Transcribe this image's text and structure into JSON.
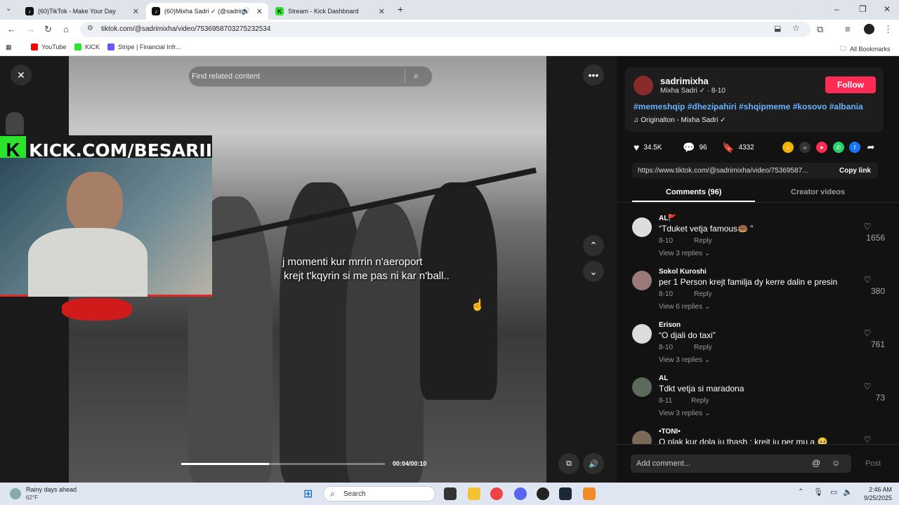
{
  "browser": {
    "tabs": [
      {
        "title": "(60)TikTok - Make Your Day",
        "active": false
      },
      {
        "title": "(60)Mixha Sadri ✓ (@sadrim",
        "active": true
      },
      {
        "title": "Stream - Kick Dashboard",
        "active": false
      }
    ],
    "url": "tiktok.com/@sadrimixha/video/7536958703275232534",
    "bookmarks": [
      {
        "label": "YouTube",
        "color": "#ff0000"
      },
      {
        "label": "KICK",
        "color": "#2ae32a"
      },
      {
        "label": "Stripe | Financial Infr...",
        "color": "#635bff"
      }
    ],
    "all_bookmarks": "All Bookmarks"
  },
  "video": {
    "search_placeholder": "Find related content",
    "caption_line1": "j momenti kur mrrin n'aeroport",
    "caption_line2": "krejt t'kqyrin si me pas ni kar n'ball..",
    "time": "00:04/00:10",
    "progress": 0.43
  },
  "overlay": {
    "kick_k": "K",
    "kick_text": "KICK.COM/BESARII"
  },
  "post": {
    "username": "sadrimixha",
    "subline": "Mixha Sadri ✓ · 8-10",
    "follow": "Follow",
    "hashtags": "#memeshqip #dhezipahiri #shqipmeme #kosovo #albania",
    "sound": "♫  Originalton - Mixha Sadri ✓",
    "likes": "34.5K",
    "comments_count": "96",
    "saves": "4332",
    "link": "https://www.tiktok.com/@sadrimixha/video/75369587...",
    "copy_link": "Copy link",
    "tab_comments": "Comments (96)",
    "tab_creator": "Creator videos",
    "add_comment": "Add comment...",
    "post_button": "Post"
  },
  "comments": [
    {
      "name": "AL🚩",
      "text": "“Tduket vetja famous🍩 ”",
      "date": "8-10",
      "reply": "Reply",
      "view": "View 3 replies ⌄",
      "likes": "1656"
    },
    {
      "name": "Sokol Kuroshi",
      "text": "per 1 Person krejt familja dy kerre dalin e presin",
      "date": "8-10",
      "reply": "Reply",
      "view": "View 6 replies ⌄",
      "likes": "380"
    },
    {
      "name": "Erison",
      "text": "“O djali do taxi”",
      "date": "8-10",
      "reply": "Reply",
      "view": "View 3 replies ⌄",
      "likes": "761"
    },
    {
      "name": "AL",
      "text": "Tdkt vetja si maradona",
      "date": "8-11",
      "reply": "Reply",
      "view": "View 3 replies ⌄",
      "likes": "73"
    },
    {
      "name": "•TONI•",
      "text": "O plak kur dola ju thash : kreit ju per mu a 🥺",
      "date": "",
      "reply": "",
      "view": "",
      "likes": ""
    }
  ],
  "taskbar": {
    "weather": "Rainy days ahead",
    "temp": "62°F",
    "search": "Search",
    "time": "2:46 AM",
    "date": "9/25/2025"
  },
  "colors": {
    "tiktok_red": "#fe2c55",
    "kick_green": "#2ae32a",
    "hashtag_blue": "#6ab4ff"
  }
}
